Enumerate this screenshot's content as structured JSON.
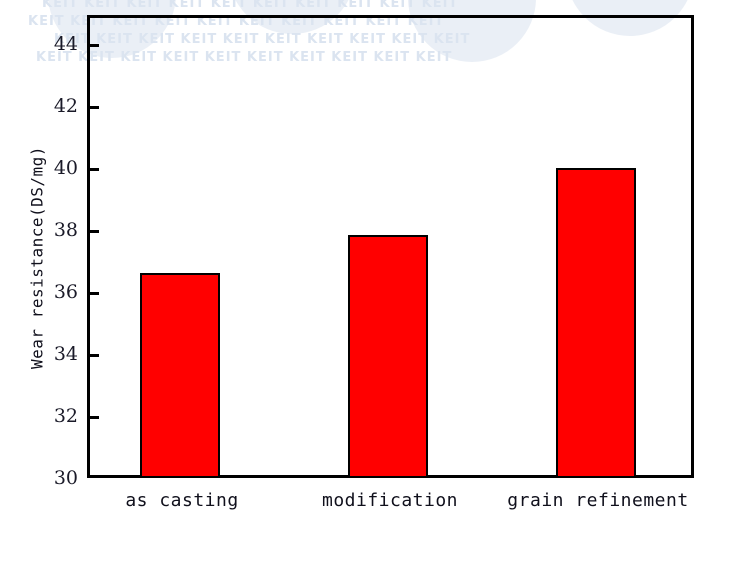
{
  "watermark": {
    "text": "KEIT KEIT KEIT KEIT KEIT KEIT KEIT KEIT KEIT KEIT",
    "color": "#dbe4f0"
  },
  "chart_data": {
    "type": "bar",
    "title": "",
    "subtitle": "",
    "xlabel": "",
    "ylabel": "Wear resistance(DS/mg)",
    "categories": [
      "as casting",
      "modification",
      "grain refinement"
    ],
    "values": [
      36.6,
      37.85,
      40.0
    ],
    "series": [
      {
        "name": "Wear resistance",
        "values": [
          36.6,
          37.85,
          40.0
        ],
        "color": "#ff0000"
      }
    ],
    "ylim": [
      30,
      45
    ],
    "yticks": [
      30,
      32,
      34,
      36,
      38,
      40,
      42,
      44
    ],
    "ytick_labels": [
      "30",
      "32",
      "34",
      "36",
      "38",
      "40",
      "42",
      "44"
    ],
    "grid": false,
    "legend": null,
    "legend_position": "none",
    "bar_color": "#ff0000",
    "bar_edge_color": "#000000",
    "axis_color": "#000000",
    "annotations": []
  }
}
